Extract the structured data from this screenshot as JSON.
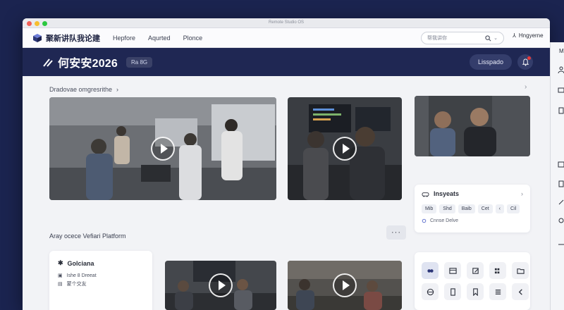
{
  "window": {
    "title": "Remote Studio OS"
  },
  "nav": {
    "brand": "聚新讲队我论建",
    "links": [
      "Hepfore",
      "Aqurted",
      "Plonce"
    ],
    "search_placeholder": "帮我讲你",
    "user": "Hngyerne"
  },
  "banner": {
    "title": "何安安2026",
    "tag": "Ra 8G",
    "pill": "Lisspado"
  },
  "breadcrumb": "Dradovae omgresrithe",
  "insights": {
    "title": "Insyeats",
    "chips": [
      "Mib",
      "Shd",
      "Baib",
      "Cet",
      "Cil"
    ],
    "footer": "Cnnse Delve"
  },
  "section": {
    "title": "Aray ocece Vefiari Platform"
  },
  "sidecard": {
    "title": "Golciana",
    "rows": [
      "Ishe 8 Dreeat",
      "蒙个交友"
    ]
  },
  "rightbar": {
    "label": "M"
  },
  "colors": {
    "navy": "#1f2753",
    "accent": "#e83a3a"
  }
}
